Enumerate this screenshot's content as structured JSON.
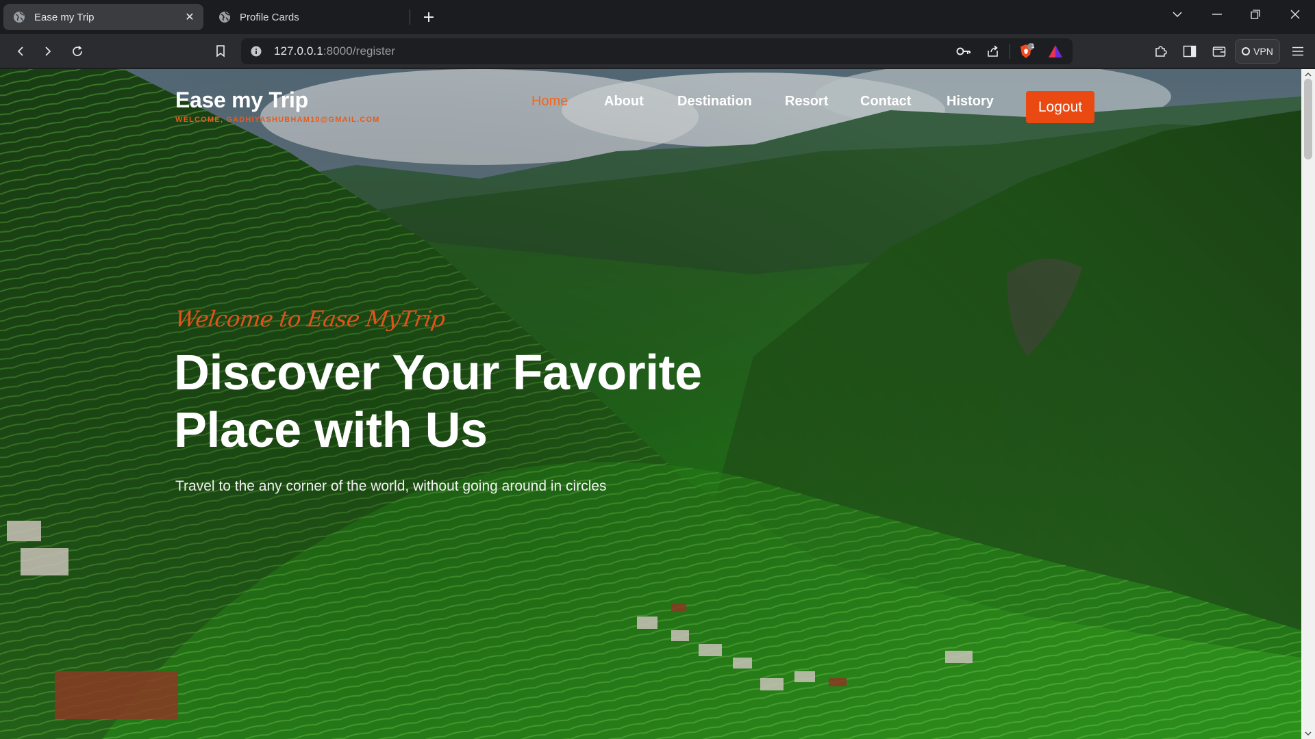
{
  "browser": {
    "tabs": [
      {
        "title": "Ease my Trip",
        "active": true
      },
      {
        "title": "Profile Cards",
        "active": false
      }
    ],
    "url_host": "127.0.0.1",
    "url_path": ":8000/register",
    "vpn_label": "VPN",
    "brave_badge": "1"
  },
  "site": {
    "brand": "Ease my Trip",
    "welcome": "WELCOME, GADHIYASHUBHAM10@GMAIL.COM",
    "nav": {
      "home": "Home",
      "about": "About",
      "destination": "Destination",
      "resort": "Resort",
      "contact": "Contact",
      "history": "History"
    },
    "logout": "Logout",
    "accent_color": "#f26522"
  },
  "hero": {
    "script_title": "Welcome to Ease MyTrip",
    "headline_line1": "Discover Your Favorite",
    "headline_line2": "Place with Us",
    "subline": "Travel to the any corner of the world, without going around in circles"
  }
}
